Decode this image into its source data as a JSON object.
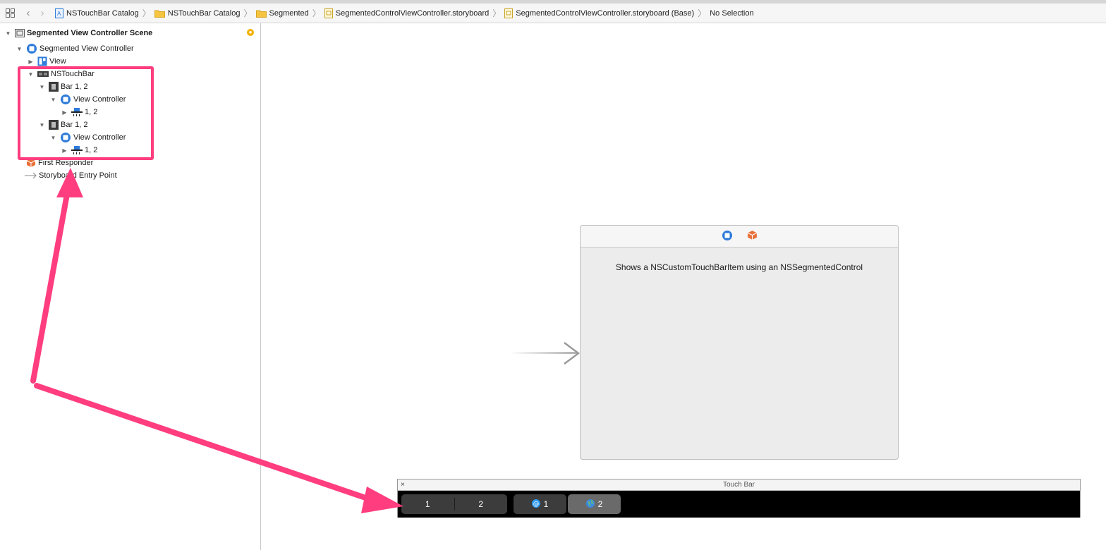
{
  "jumpbar": {
    "crumbs": [
      {
        "label": "NSTouchBar Catalog"
      },
      {
        "label": "NSTouchBar Catalog"
      },
      {
        "label": "Segmented"
      },
      {
        "label": "SegmentedControlViewController.storyboard"
      },
      {
        "label": "SegmentedControlViewController.storyboard (Base)"
      },
      {
        "label": "No Selection"
      }
    ]
  },
  "outline": {
    "scene": "Segmented View Controller Scene",
    "vc": "Segmented View Controller",
    "view": "View",
    "touchbar": "NSTouchBar",
    "bar1": "Bar 1, 2",
    "vc1": "View Controller",
    "seg1": "1, 2",
    "bar2": "Bar 1, 2",
    "vc2": "View Controller",
    "seg2": "1, 2",
    "first_responder": "First Responder",
    "entry_point": "Storyboard Entry Point"
  },
  "scene": {
    "label": "Shows a NSCustomTouchBarItem using an NSSegmentedControl"
  },
  "touchbar": {
    "title": "Touch Bar",
    "close": "×",
    "segments": [
      "1",
      "2"
    ],
    "btn1": "1",
    "btn2": "2"
  },
  "colors": {
    "highlight": "#ff3d7f",
    "icon_blue": "#2e7bd9",
    "touchbar_bg": "#000000"
  }
}
